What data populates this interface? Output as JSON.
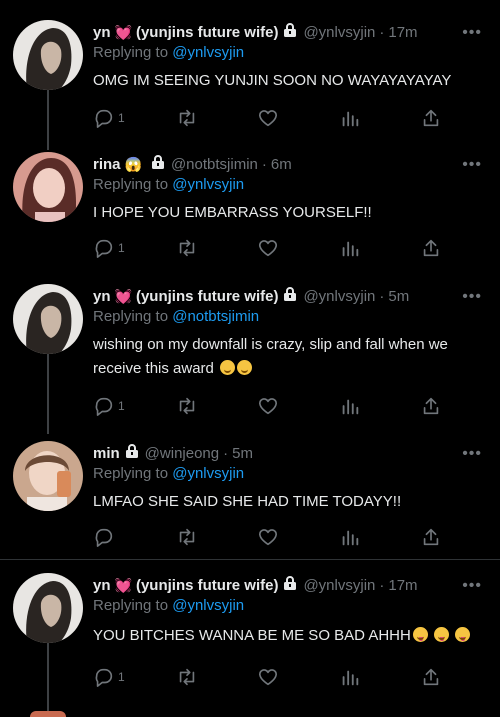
{
  "more_label": "•••",
  "tweets": [
    {
      "name": "yn",
      "name_suffix": "(yunjins future wife)",
      "handle": "@ynlvsyjin",
      "time": "17m",
      "reply_prefix": "Replying to",
      "reply_to": "@ynlvsyjin",
      "text": "OMG IM SEEING YUNJIN SOON NO WAYAYAYAYAY",
      "reply_count": "1",
      "emojis": ""
    },
    {
      "name": "rina",
      "name_suffix": "",
      "handle": "@notbtsjimin",
      "time": "6m",
      "reply_prefix": "Replying to",
      "reply_to": "@ynlvsyjin",
      "text": "I HOPE YOU EMBARRASS YOURSELF!!",
      "reply_count": "1",
      "emojis": ""
    },
    {
      "name": "yn",
      "name_suffix": "(yunjins future wife)",
      "handle": "@ynlvsyjin",
      "time": "5m",
      "reply_prefix": "Replying to",
      "reply_to": "@notbtsjimin",
      "text": "wishing on my downfall is crazy, slip and fall when we receive this award",
      "reply_count": "1",
      "emojis": ""
    },
    {
      "name": "min",
      "name_suffix": "",
      "handle": "@winjeong",
      "time": "5m",
      "reply_prefix": "Replying to",
      "reply_to": "@ynlvsyjin",
      "text": "LMFAO SHE SAID SHE HAD TIME TODAYY!!",
      "reply_count": "",
      "emojis": ""
    },
    {
      "name": "yn",
      "name_suffix": "(yunjins future wife)",
      "handle": "@ynlvsyjin",
      "time": "17m",
      "reply_prefix": "Replying to",
      "reply_to": "@ynlvsyjin",
      "text": "YOU BITCHES WANNA BE ME SO BAD AHHH",
      "reply_count": "1",
      "emojis": ""
    }
  ],
  "colors": {
    "background": "#000000",
    "text": "#e7e9ea",
    "muted": "#71767b",
    "link": "#1d9bf0",
    "divider": "#2f3336"
  },
  "icons": [
    "reply-icon",
    "retweet-icon",
    "like-icon",
    "analytics-icon",
    "share-icon",
    "lock-icon",
    "heart-emoji-icon"
  ]
}
